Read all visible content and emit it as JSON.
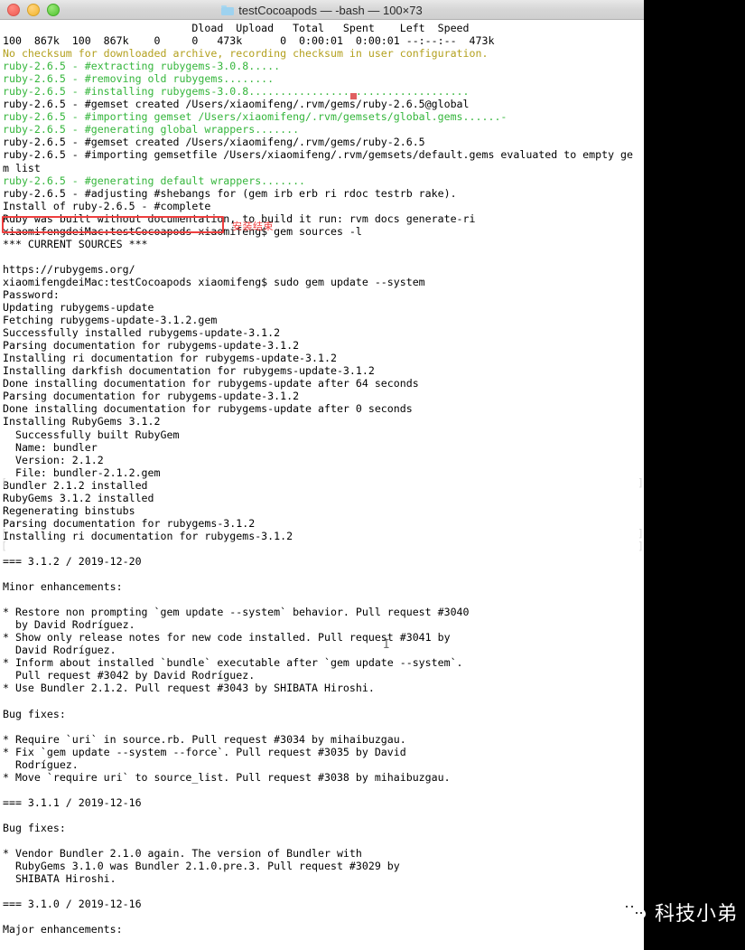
{
  "window": {
    "title": "testCocoapods — -bash — 100×73",
    "folder_icon": "folder-icon",
    "traffic_lights": [
      {
        "name": "close",
        "color": "#ef5a52"
      },
      {
        "name": "minimize",
        "color": "#f2b52c"
      },
      {
        "name": "maximize",
        "color": "#4fc22e"
      }
    ]
  },
  "colors": {
    "terminal_bg": "#ffffff",
    "terminal_fg": "#000000",
    "green": "#35b63c",
    "yellow": "#b3a01e",
    "annotation_red": "#ef3f3f",
    "page_bg": "#000000",
    "watermark_text": "#ffffff"
  },
  "annotation": {
    "label": "安装结束",
    "boxed_text": "Install of ruby-2.6.5 - #complete"
  },
  "watermark": {
    "text": "科技小弟",
    "icon": "wechat-icon"
  },
  "cursor": {
    "glyph": "I",
    "name": "text-ibeam-cursor"
  },
  "terminal": {
    "columns": 100,
    "rows": 73,
    "lines": [
      {
        "color": "white",
        "text": "                              Dload  Upload   Total   Spent    Left  Speed"
      },
      {
        "color": "white",
        "text": "100  867k  100  867k    0     0   473k      0  0:00:01  0:00:01 --:--:--  473k"
      },
      {
        "color": "yellow",
        "text": "No checksum for downloaded archive, recording checksum in user configuration."
      },
      {
        "color": "green",
        "text": "ruby-2.6.5 - #extracting rubygems-3.0.8....."
      },
      {
        "color": "green",
        "text": "ruby-2.6.5 - #removing old rubygems........"
      },
      {
        "color": "green",
        "text": "ruby-2.6.5 - #installing rubygems-3.0.8..................................."
      },
      {
        "color": "white",
        "text": "ruby-2.6.5 - #gemset created /Users/xiaomifeng/.rvm/gems/ruby-2.6.5@global"
      },
      {
        "color": "green",
        "text": "ruby-2.6.5 - #importing gemset /Users/xiaomifeng/.rvm/gemsets/global.gems......-"
      },
      {
        "color": "green",
        "text": "ruby-2.6.5 - #generating global wrappers......."
      },
      {
        "color": "white",
        "text": "ruby-2.6.5 - #gemset created /Users/xiaomifeng/.rvm/gems/ruby-2.6.5"
      },
      {
        "color": "white",
        "text": "ruby-2.6.5 - #importing gemsetfile /Users/xiaomifeng/.rvm/gemsets/default.gems evaluated to empty ge"
      },
      {
        "color": "white",
        "text": "m list"
      },
      {
        "color": "green",
        "text": "ruby-2.6.5 - #generating default wrappers......."
      },
      {
        "color": "white",
        "text": "ruby-2.6.5 - #adjusting #shebangs for (gem irb erb ri rdoc testrb rake)."
      },
      {
        "color": "white",
        "text": "Install of ruby-2.6.5 - #complete"
      },
      {
        "color": "white",
        "text": "Ruby was built without documentation, to build it run: rvm docs generate-ri"
      },
      {
        "color": "white",
        "text": "xiaomifengdeiMac:testCocoapods xiaomifeng$ gem sources -l"
      },
      {
        "color": "white",
        "text": "*** CURRENT SOURCES ***"
      },
      {
        "color": "white",
        "text": ""
      },
      {
        "color": "white",
        "text": "https://rubygems.org/"
      },
      {
        "color": "white",
        "text": "xiaomifengdeiMac:testCocoapods xiaomifeng$ sudo gem update --system"
      },
      {
        "color": "white",
        "text": "Password:"
      },
      {
        "color": "white",
        "text": "Updating rubygems-update"
      },
      {
        "color": "white",
        "text": "Fetching rubygems-update-3.1.2.gem"
      },
      {
        "color": "white",
        "text": "Successfully installed rubygems-update-3.1.2"
      },
      {
        "color": "white",
        "text": "Parsing documentation for rubygems-update-3.1.2"
      },
      {
        "color": "white",
        "text": "Installing ri documentation for rubygems-update-3.1.2"
      },
      {
        "color": "white",
        "text": "Installing darkfish documentation for rubygems-update-3.1.2"
      },
      {
        "color": "white",
        "text": "Done installing documentation for rubygems-update after 64 seconds"
      },
      {
        "color": "white",
        "text": "Parsing documentation for rubygems-update-3.1.2"
      },
      {
        "color": "white",
        "text": "Done installing documentation for rubygems-update after 0 seconds"
      },
      {
        "color": "white",
        "text": "Installing RubyGems 3.1.2"
      },
      {
        "color": "white",
        "text": "  Successfully built RubyGem"
      },
      {
        "color": "white",
        "text": "  Name: bundler"
      },
      {
        "color": "white",
        "text": "  Version: 2.1.2"
      },
      {
        "color": "white",
        "text": "  File: bundler-2.1.2.gem"
      },
      {
        "color": "white",
        "text": "Bundler 2.1.2 installed"
      },
      {
        "color": "white",
        "text": "RubyGems 3.1.2 installed"
      },
      {
        "color": "white",
        "text": "Regenerating binstubs"
      },
      {
        "color": "white",
        "text": "Parsing documentation for rubygems-3.1.2"
      },
      {
        "color": "white",
        "text": "Installing ri documentation for rubygems-3.1.2"
      },
      {
        "color": "white",
        "text": ""
      },
      {
        "color": "white",
        "text": "=== 3.1.2 / 2019-12-20"
      },
      {
        "color": "white",
        "text": ""
      },
      {
        "color": "white",
        "text": "Minor enhancements:"
      },
      {
        "color": "white",
        "text": ""
      },
      {
        "color": "white",
        "text": "* Restore non prompting `gem update --system` behavior. Pull request #3040"
      },
      {
        "color": "white",
        "text": "  by David Rodríguez."
      },
      {
        "color": "white",
        "text": "* Show only release notes for new code installed. Pull request #3041 by"
      },
      {
        "color": "white",
        "text": "  David Rodríguez."
      },
      {
        "color": "white",
        "text": "* Inform about installed `bundle` executable after `gem update --system`."
      },
      {
        "color": "white",
        "text": "  Pull request #3042 by David Rodríguez."
      },
      {
        "color": "white",
        "text": "* Use Bundler 2.1.2. Pull request #3043 by SHIBATA Hiroshi."
      },
      {
        "color": "white",
        "text": ""
      },
      {
        "color": "white",
        "text": "Bug fixes:"
      },
      {
        "color": "white",
        "text": ""
      },
      {
        "color": "white",
        "text": "* Require `uri` in source.rb. Pull request #3034 by mihaibuzgau."
      },
      {
        "color": "white",
        "text": "* Fix `gem update --system --force`. Pull request #3035 by David"
      },
      {
        "color": "white",
        "text": "  Rodríguez."
      },
      {
        "color": "white",
        "text": "* Move `require uri` to source_list. Pull request #3038 by mihaibuzgau."
      },
      {
        "color": "white",
        "text": ""
      },
      {
        "color": "white",
        "text": "=== 3.1.1 / 2019-12-16"
      },
      {
        "color": "white",
        "text": ""
      },
      {
        "color": "white",
        "text": "Bug fixes:"
      },
      {
        "color": "white",
        "text": ""
      },
      {
        "color": "white",
        "text": "* Vendor Bundler 2.1.0 again. The version of Bundler with"
      },
      {
        "color": "white",
        "text": "  RubyGems 3.1.0 was Bundler 2.1.0.pre.3. Pull request #3029 by"
      },
      {
        "color": "white",
        "text": "  SHIBATA Hiroshi."
      },
      {
        "color": "white",
        "text": ""
      },
      {
        "color": "white",
        "text": "=== 3.1.0 / 2019-12-16"
      },
      {
        "color": "white",
        "text": ""
      },
      {
        "color": "white",
        "text": "Major enhancements:"
      }
    ]
  }
}
